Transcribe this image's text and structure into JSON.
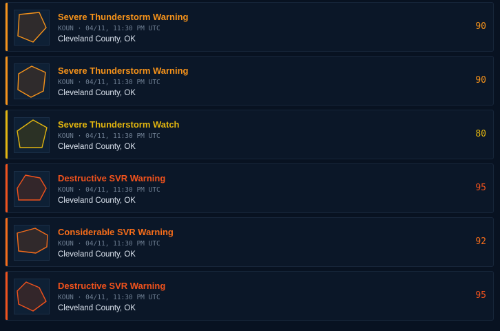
{
  "alerts": [
    {
      "title": "Severe Thunderstorm Warning",
      "station": "KOUN",
      "time": "04/11, 11:30 PM UTC",
      "area": "Cleveland County, OK",
      "score": "90",
      "color": "#f7931a",
      "polygon_fill": "#2f2b2c"
    },
    {
      "title": "Severe Thunderstorm Warning",
      "station": "KOUN",
      "time": "04/11, 11:30 PM UTC",
      "area": "Cleveland County, OK",
      "score": "90",
      "color": "#f7931a",
      "polygon_fill": "#2f2b2c"
    },
    {
      "title": "Severe Thunderstorm Watch",
      "station": "KOUN",
      "time": "04/11, 11:30 PM UTC",
      "area": "Cleveland County, OK",
      "score": "80",
      "color": "#e3b60f",
      "polygon_fill": "#2b3125"
    },
    {
      "title": "Destructive SVR Warning",
      "station": "KOUN",
      "time": "04/11, 11:30 PM UTC",
      "area": "Cleveland County, OK",
      "score": "95",
      "color": "#f2521c",
      "polygon_fill": "#33262a"
    },
    {
      "title": "Considerable SVR Warning",
      "station": "KOUN",
      "time": "04/11, 11:30 PM UTC",
      "area": "Cleveland County, OK",
      "score": "92",
      "color": "#f76d1a",
      "polygon_fill": "#30292b"
    },
    {
      "title": "Destructive SVR Warning",
      "station": "KOUN",
      "time": "04/11, 11:30 PM UTC",
      "area": "Cleveland County, OK",
      "score": "95",
      "color": "#f2521c",
      "polygon_fill": "#33262a"
    }
  ],
  "meta_separator": "·"
}
